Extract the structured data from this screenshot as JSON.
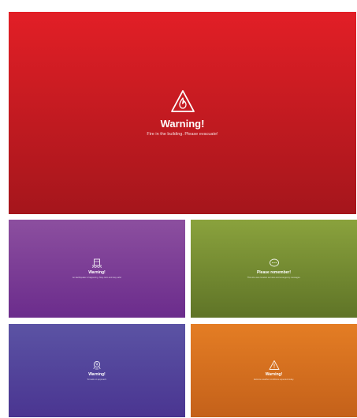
{
  "main": {
    "title": "Warning!",
    "message": "Fire in the building. Please evacuate!",
    "icon": "fire-warning-icon",
    "colors": {
      "top": "#e21f26",
      "bottom": "#a5161c"
    }
  },
  "cards": [
    {
      "id": "purple",
      "title": "Warning!",
      "message": "An Earthquake is happening. Stay calm and stay safe!",
      "icon": "earthquake-building-icon",
      "colors": {
        "top": "#8c4f9f",
        "bottom": "#6b2c8c"
      }
    },
    {
      "id": "green",
      "title": "Please remember!",
      "message": "This site uses location services and emergency messages.",
      "icon": "speech-bubble-icon",
      "colors": {
        "top": "#8aa23d",
        "bottom": "#5f7427"
      }
    },
    {
      "id": "indigo",
      "title": "Warning!",
      "message": "Tornado on approach.",
      "icon": "tornado-icon",
      "colors": {
        "top": "#5b53a4",
        "bottom": "#4a3591"
      }
    },
    {
      "id": "orange",
      "title": "Warning!",
      "message": "Extreme weather conditions expected today.",
      "icon": "warning-triangle-icon",
      "colors": {
        "top": "#e47d24",
        "bottom": "#c4611a"
      }
    }
  ]
}
